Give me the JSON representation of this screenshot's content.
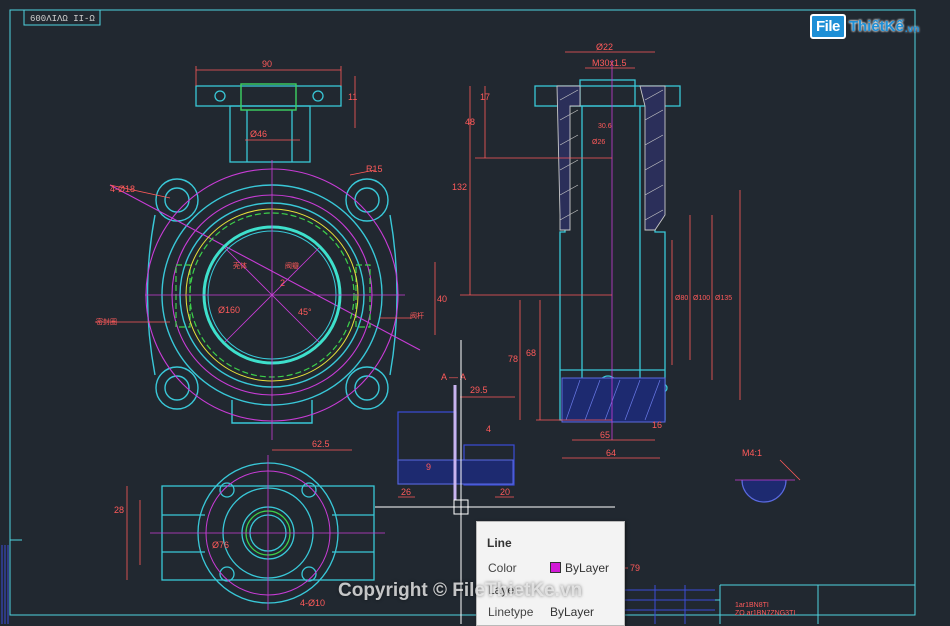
{
  "watermark_top_left": "600ΛΙΛΩ ΙΙ-Ω",
  "logo": {
    "brand": "File",
    "name": "ThiếtKế",
    "domain": ".vn"
  },
  "copyright": "Copyright © FileThietKe.vn",
  "tooltip": {
    "title": "Line",
    "rows": [
      {
        "label": "Color",
        "value": "ByLayer",
        "swatch": "#d21ad6"
      },
      {
        "label": "Layer",
        "value": ""
      },
      {
        "label": "Linetype",
        "value": "ByLayer"
      }
    ]
  },
  "dimensions": {
    "top_width": "90",
    "top_height": "11",
    "flange_bore": "Ø46",
    "bolt_holes": "4-Ø18",
    "radius": "R15",
    "body_dia": "Ø160",
    "angle": "45°",
    "label_a": "2",
    "side_40": "40",
    "bottom_width": "62.5",
    "view_label": "A — A",
    "section_29_5": "29.5",
    "section_9": "9",
    "section_26": "26",
    "section_20": "20",
    "section_4": "4",
    "right_top": "Ø22",
    "right_stem": "M30x1.5",
    "right_17": "17",
    "right_48": "48",
    "right_132": "132",
    "right_78": "78",
    "right_68": "68",
    "right_30_6": "30.6",
    "right_26": "Ø26",
    "right_dia_a": "Ø100",
    "right_dia_b": "Ø135",
    "right_dia_c": "Ø80",
    "right_16": "16",
    "right_65": "65",
    "right_64": "64",
    "detail_scale": "M4:1",
    "bottom_28": "28",
    "bottom_n": "4-Ø10",
    "bottom_76": "Ø76",
    "ref_79": "79",
    "callout_1": "壳体",
    "callout_2": "阀瓣",
    "callout_3": "密封圈",
    "callout_4": "阀杆"
  },
  "title_block": {
    "line1": "1ar1BN8TI",
    "line2": "ZO ar1BN7ZNG3TI"
  },
  "colors": {
    "background": "#212830",
    "border": "#4fd3e0",
    "cyan": "#39c8d8",
    "green": "#3dd04a",
    "magenta": "#c83cd6",
    "red_dim": "#ff5a5a",
    "yellow": "#e8e23a",
    "blue": "#3a4cd8"
  }
}
